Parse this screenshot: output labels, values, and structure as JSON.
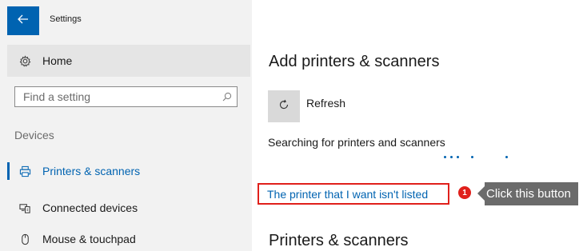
{
  "window": {
    "title": "Settings"
  },
  "sidebar": {
    "home_label": "Home",
    "search_placeholder": "Find a setting",
    "section_label": "Devices",
    "items": [
      {
        "label": "Printers & scanners",
        "icon": "printer-icon",
        "active": true
      },
      {
        "label": "Connected devices",
        "icon": "connected-devices-icon",
        "active": false
      },
      {
        "label": "Mouse & touchpad",
        "icon": "mouse-icon",
        "active": false
      }
    ]
  },
  "main": {
    "heading": "Add printers & scanners",
    "refresh_label": "Refresh",
    "status_text": "Searching for printers and scanners",
    "link_text": "The printer that I want isn't listed",
    "section_heading": "Printers & scanners"
  },
  "annotation": {
    "number": "1",
    "text": "Click this button"
  },
  "colors": {
    "accent": "#0063b1",
    "highlight_border": "#e0201b",
    "callout_bg": "#6b6b6b",
    "sidebar_bg": "#f2f2f2"
  }
}
